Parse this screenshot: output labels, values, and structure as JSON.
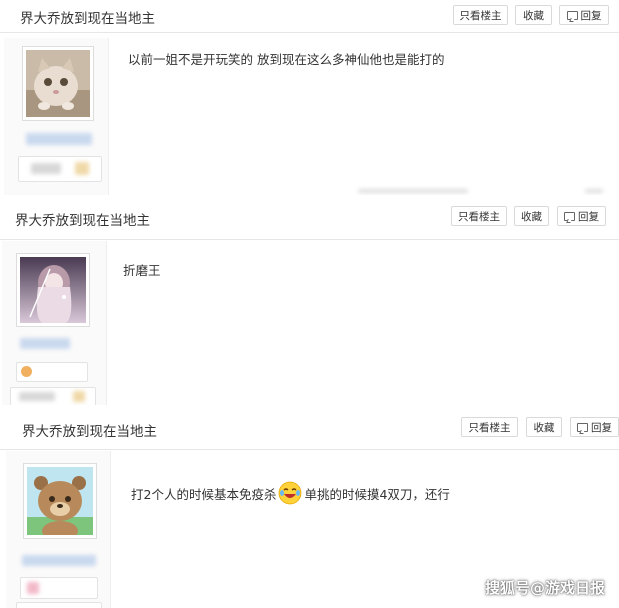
{
  "actions": {
    "only_op": "只看楼主",
    "favorite": "收藏",
    "reply": "回复"
  },
  "posts": [
    {
      "thread_title": "界大乔放到现在当地主",
      "content": "以前一姐不是开玩笑的 放到现在这么多神仙他也是能打的"
    },
    {
      "thread_title": "界大乔放到现在当地主",
      "content": "折磨王"
    },
    {
      "thread_title": "界大乔放到现在当地主",
      "content_part1": "打2个人的时候基本免疫杀",
      "content_part2": "单挑的时候摸4双刀，还行"
    }
  ],
  "watermark": "搜狐号@游戏日报",
  "icons": {
    "reply": "reply-icon",
    "emoji": "laughing-crying-emoji-icon"
  }
}
